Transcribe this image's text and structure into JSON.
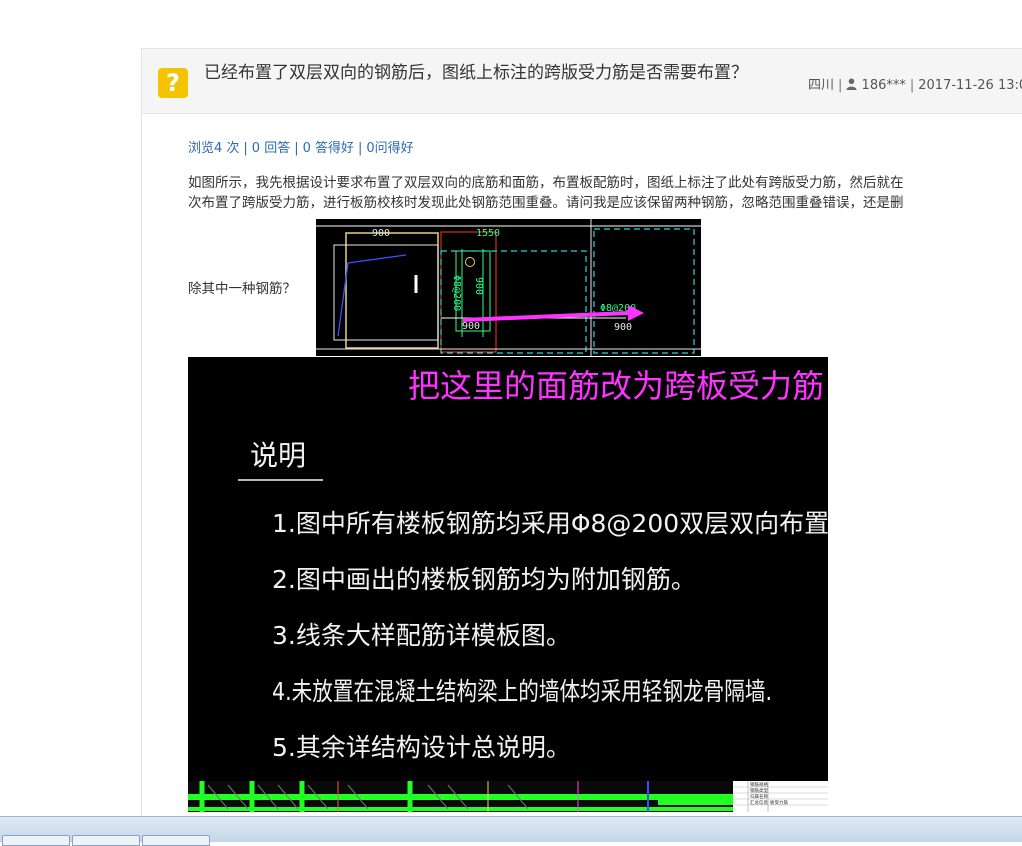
{
  "question": {
    "title": "已经布置了双层双向的钢筋后，图纸上标注的跨版受力筋是否需要布置？",
    "location": "四川",
    "user": "186***",
    "date": "2017-11-26 13:0",
    "icon": "question-mark-icon"
  },
  "stats": {
    "views": "浏览4 次",
    "answers": "0 回答",
    "good": "0 答得好",
    "asks": "0问得好"
  },
  "body": {
    "line1": "如图所示，我先根据设计要求布置了双层双向的底筋和面筋，布置板配筋时，图纸上标注了此处有跨版受力筋，然后就在",
    "line2": "次布置了跨版受力筋，进行板筋校核时发现此处钢筋范围重叠。请问我是应该保留两种钢筋，忽略范围重叠错误，还是删",
    "line3": "除其中一种钢筋？"
  },
  "drawing1": {
    "dim_900_top": "900",
    "dim_1550": "1550",
    "rebar_left": "Φ8@200",
    "dim_900_vert": "900",
    "dim_900_bottom": "900",
    "rebar_right": "Φ8@200",
    "dim_900_right": "900",
    "arrow_color": "#ff33ff"
  },
  "drawing2": {
    "annotation": "把这里的面筋改为跨板受力筋",
    "heading": "说明",
    "notes": [
      "1.图中所有楼板钢筋均采用Φ8@200双层双向布置。",
      "2.图中画出的楼板钢筋均为附加钢筋。",
      "3.线条大样配筋详模板图。",
      "4.未放置在混凝土结构梁上的墙体均采用轻钢龙骨隔墙.",
      "5.其余详结构设计总说明。"
    ],
    "annotation_color": "#ff33ff",
    "table": [
      "钢筋规格",
      "钢筋类型",
      "归属名称",
      "汇总信息",
      "板受力筋"
    ]
  }
}
